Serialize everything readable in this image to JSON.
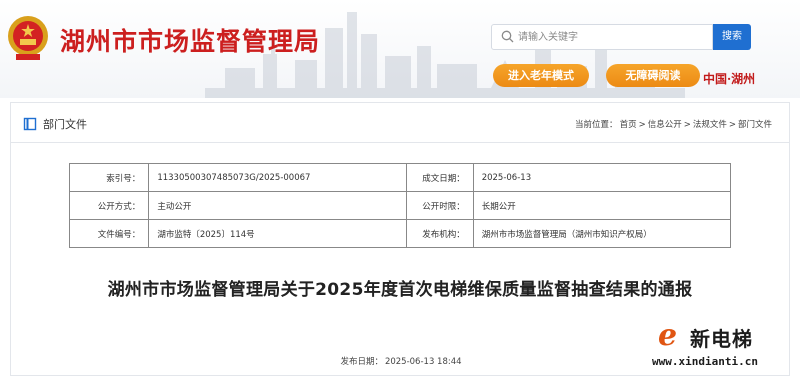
{
  "header": {
    "site_title": "湖州市市场监督管理局",
    "search_placeholder": "请输入关键字",
    "search_button": "搜索",
    "elder_mode": "进入老年模式",
    "accessible": "无障碍阅读",
    "china_logo": "中国·湖州"
  },
  "bar": {
    "section": "部门文件",
    "crumb_label": "当前位置：",
    "crumbs": [
      "首页",
      "信息公开",
      "法规文件",
      "部门文件"
    ],
    "crumb_sep": ">"
  },
  "meta": [
    {
      "k1": "索引号：",
      "v1": "11330500307485073G/2025-00067",
      "k2": "成文日期：",
      "v2": "2025-06-13"
    },
    {
      "k1": "公开方式：",
      "v1": "主动公开",
      "k2": "公开时限：",
      "v2": "长期公开"
    },
    {
      "k1": "文件编号：",
      "v1": "湖市监特〔2025〕114号",
      "k2": "发布机构：",
      "v2": "湖州市市场监督管理局（湖州市知识产权局）"
    }
  ],
  "doc": {
    "title": "湖州市市场监督管理局关于2025年度首次电梯维保质量监督抽查结果的通报",
    "pub_label": "发布日期：",
    "pub_date": "2025-06-13 18:44"
  },
  "watermark": {
    "name": "新电梯",
    "url": "www.xindianti.cn"
  },
  "colors": {
    "brand_red": "#cc1f1f",
    "button_blue": "#1f6fd1",
    "pill_orange": "#ec8a14"
  }
}
